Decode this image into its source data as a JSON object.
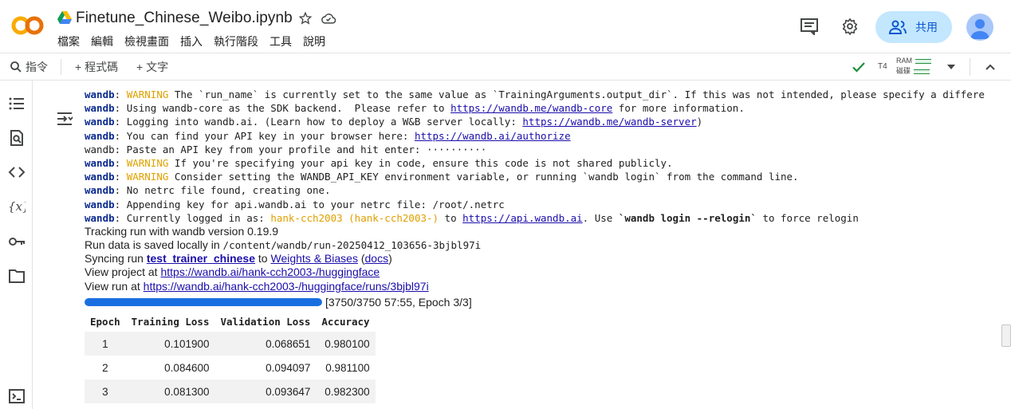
{
  "header": {
    "title": "Finetune_Chinese_Weibo.ipynb",
    "menu": [
      "檔案",
      "編輯",
      "檢視畫面",
      "插入",
      "執行階段",
      "工具",
      "說明"
    ],
    "share_label": "共用"
  },
  "toolbar": {
    "command_label": "指令",
    "add_code_label": "+ 程式碼",
    "add_text_label": "+ 文字",
    "runtime": "T4",
    "ram_label": "RAM",
    "disk_label": "磁碟"
  },
  "output": {
    "log_lines": [
      {
        "prefix": "wandb",
        "warn": "WARNING",
        "text": " The `run_name` is currently set to the same value as `TrainingArguments.output_dir`. If this was not intended, please specify a differe"
      },
      {
        "prefix": "wandb",
        "text_a": ": Using wandb-core as the SDK backend.  Please refer to ",
        "link": "https://wandb.me/wandb-core",
        "text_b": " for more information."
      },
      {
        "prefix": "wandb",
        "text_a": ": Logging into wandb.ai. (Learn how to deploy a W&B server locally: ",
        "link": "https://wandb.me/wandb-server",
        "text_b": ")"
      },
      {
        "prefix": "wandb",
        "text_a": ": You can find your API key in your browser here: ",
        "link": "https://wandb.ai/authorize",
        "text_b": ""
      },
      {
        "plain": "wandb: Paste an API key from your profile and hit enter: ··········"
      },
      {
        "prefix": "wandb",
        "warn": "WARNING",
        "text": " If you're specifying your api key in code, ensure this code is not shared publicly."
      },
      {
        "prefix": "wandb",
        "warn": "WARNING",
        "text": " Consider setting the WANDB_API_KEY environment variable, or running `wandb login` from the command line."
      },
      {
        "prefix": "wandb",
        "text": ": No netrc file found, creating one."
      },
      {
        "prefix": "wandb",
        "text": ": Appending key for api.wandb.ai to your netrc file: /root/.netrc"
      }
    ],
    "logged_in": {
      "prefix": "wandb",
      "text_a": ": Currently logged in as: ",
      "user": "hank-cch2003",
      "entity": "(hank-cch2003-)",
      "text_b": " to ",
      "link": "https://api.wandb.ai",
      "text_c": ". Use ",
      "cmd": "`wandb login --relogin`",
      "text_d": " to force relogin"
    },
    "tracking": "Tracking run with wandb version 0.19.9",
    "run_data_prefix": "Run data is saved locally in ",
    "run_data_path": "/content/wandb/run-20250412_103656-3bjbl97i",
    "syncing_prefix": "Syncing run ",
    "run_name": "test_trainer_chinese",
    "syncing_to": " to ",
    "wb_link": "Weights & Biases",
    "docs_open": " (",
    "docs_link": "docs",
    "docs_close": ")",
    "view_project_prefix": "View project at ",
    "project_link": "https://wandb.ai/hank-cch2003-/huggingface",
    "view_run_prefix": "View run at ",
    "run_link": "https://wandb.ai/hank-cch2003-/huggingface/runs/3bjbl97i",
    "progress": {
      "fraction": 1.0,
      "text": "[3750/3750 57:55, Epoch 3/3]"
    },
    "table": {
      "headers": [
        "Epoch",
        "Training Loss",
        "Validation Loss",
        "Accuracy"
      ],
      "rows": [
        [
          "1",
          "0.101900",
          "0.068651",
          "0.980100"
        ],
        [
          "2",
          "0.084600",
          "0.094097",
          "0.981100"
        ],
        [
          "3",
          "0.081300",
          "0.093647",
          "0.982300"
        ]
      ]
    }
  },
  "colors": {
    "accent": "#0b57d0",
    "share_bg": "#c2e7ff",
    "warning": "#e0a100",
    "progress": "#1a6fe0"
  }
}
